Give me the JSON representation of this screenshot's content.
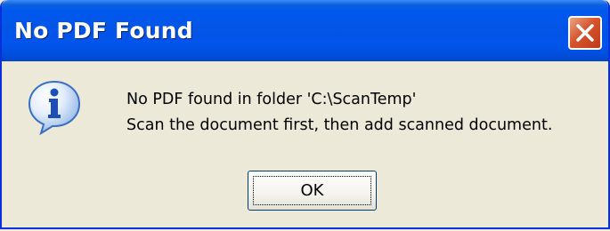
{
  "dialog": {
    "title": "No PDF Found",
    "icon": "information-icon",
    "message_lines": [
      "No PDF found in folder 'C:\\ScanTemp'",
      "Scan the document first, then add scanned document."
    ],
    "ok_label": "OK"
  },
  "colors": {
    "titlebar": "#0054e3",
    "window_bg": "#ece9d8",
    "close_button": "#d5552e",
    "info_icon": "#2f6fd6"
  }
}
